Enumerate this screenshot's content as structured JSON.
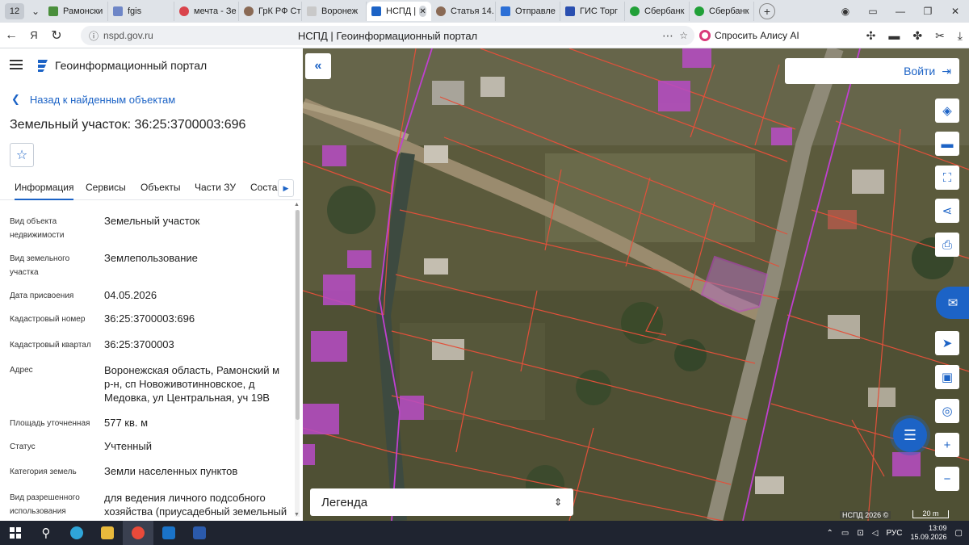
{
  "browser": {
    "tab_count": "12",
    "tabs": [
      {
        "label": "Рамонски",
        "icon": "document-icon",
        "color": "#4a8f3c"
      },
      {
        "label": "fgis",
        "icon": "gear-icon",
        "color": "#6e86c7"
      },
      {
        "label": "мечта - Зе",
        "icon": "dots-icon",
        "color": "#d9434b"
      },
      {
        "label": "ГрК РФ Ст",
        "icon": "law-icon",
        "color": "#8a6a55"
      },
      {
        "label": "Воронеж",
        "icon": "document-icon",
        "color": "#c9c9c9"
      },
      {
        "label": "НСПД |",
        "icon": "nspd-icon",
        "color": "#1c63c6"
      },
      {
        "label": "Статья 14.",
        "icon": "law-icon",
        "color": "#8a6a55"
      },
      {
        "label": "Отправле",
        "icon": "mail-icon",
        "color": "#2b6fd6"
      },
      {
        "label": "ГИС Торг",
        "icon": "gov-icon",
        "color": "#2a4fb0"
      },
      {
        "label": "Сбербанк",
        "icon": "sber-icon",
        "color": "#21a038"
      },
      {
        "label": "Сбербанк",
        "icon": "sber-icon",
        "color": "#21a038"
      }
    ],
    "url": "nspd.gov.ru",
    "page_title": "НСПД | Геоинформационный портал",
    "alice_label": "Спросить Алису AI"
  },
  "panel": {
    "portal_title": "Геоинформационный портал",
    "back_label": "Назад к найденным объектам",
    "object_title": "Земельный участок: 36:25:3700003:696",
    "tabs": [
      "Информация",
      "Сервисы",
      "Объекты",
      "Части ЗУ",
      "Состав"
    ],
    "properties": [
      {
        "label": "Вид объекта недвижимости",
        "value": "Земельный участок"
      },
      {
        "label": "Вид земельного участка",
        "value": "Землепользование"
      },
      {
        "label": "Дата присвоения",
        "value": "04.05.2026"
      },
      {
        "label": "Кадастровый номер",
        "value": "36:25:3700003:696"
      },
      {
        "label": "Кадастровый квартал",
        "value": "36:25:3700003"
      },
      {
        "label": "Адрес",
        "value": "Воронежская область, Рамонский м р-н, сп Новоживотинновское, д Медовка, ул Центральная, уч 19В"
      },
      {
        "label": "Площадь уточненная",
        "value": "577 кв. м"
      },
      {
        "label": "Статус",
        "value": "Учтенный"
      },
      {
        "label": "Категория земель",
        "value": "Земли населенных пунктов"
      },
      {
        "label": "Вид разрешенного использования",
        "value": "для ведения личного подсобного хозяйства (приусадебный земельный"
      }
    ]
  },
  "map": {
    "login_label": "Войти",
    "legend_label": "Легенда",
    "attribution": "НСПД 2026 ©",
    "scale_label": "20 m",
    "tools": [
      "layers-icon",
      "ruler-icon",
      "select-area-icon",
      "share-icon",
      "print-icon",
      "assistant-icon",
      "locate-icon",
      "minimap-icon",
      "geolocation-icon",
      "zoom-in-icon",
      "zoom-out-icon"
    ],
    "colors": {
      "parcel_line": "#e2503a",
      "highlight": "#c040d0",
      "accent": "#1c63c6"
    }
  },
  "taskbar": {
    "lang": "РУС",
    "time": "13:09",
    "date": "15.09.2026"
  }
}
